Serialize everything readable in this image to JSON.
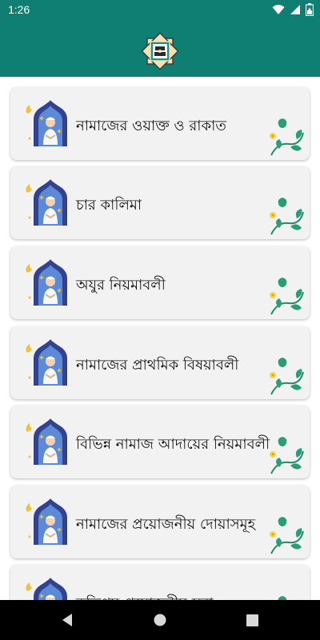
{
  "status_bar": {
    "time": "1:26",
    "icons": [
      "wifi-icon",
      "signal-icon",
      "battery-icon"
    ]
  },
  "app_bar": {
    "logo_icon": "app-emblem-icon",
    "background_color": "#0f7f74"
  },
  "menu": {
    "items": [
      {
        "label": "নামাজের ওয়াক্ত ও রাকাত"
      },
      {
        "label": "চার কালিমা"
      },
      {
        "label": "অযুর নিয়মাবলী"
      },
      {
        "label": "নামাজের প্রাথমিক বিষয়াবলী"
      },
      {
        "label": "বিভিন্ন নামাজ আদায়ের নিয়মাবলী"
      },
      {
        "label": "নামাজের প্রয়োজনীয় দোয়াসমূহ"
      },
      {
        "label": "কতিপয় প্রয়োজনীয় সূরা"
      }
    ]
  },
  "nav_bar": {
    "back": "back-icon",
    "home": "home-icon",
    "recents": "recents-icon"
  }
}
